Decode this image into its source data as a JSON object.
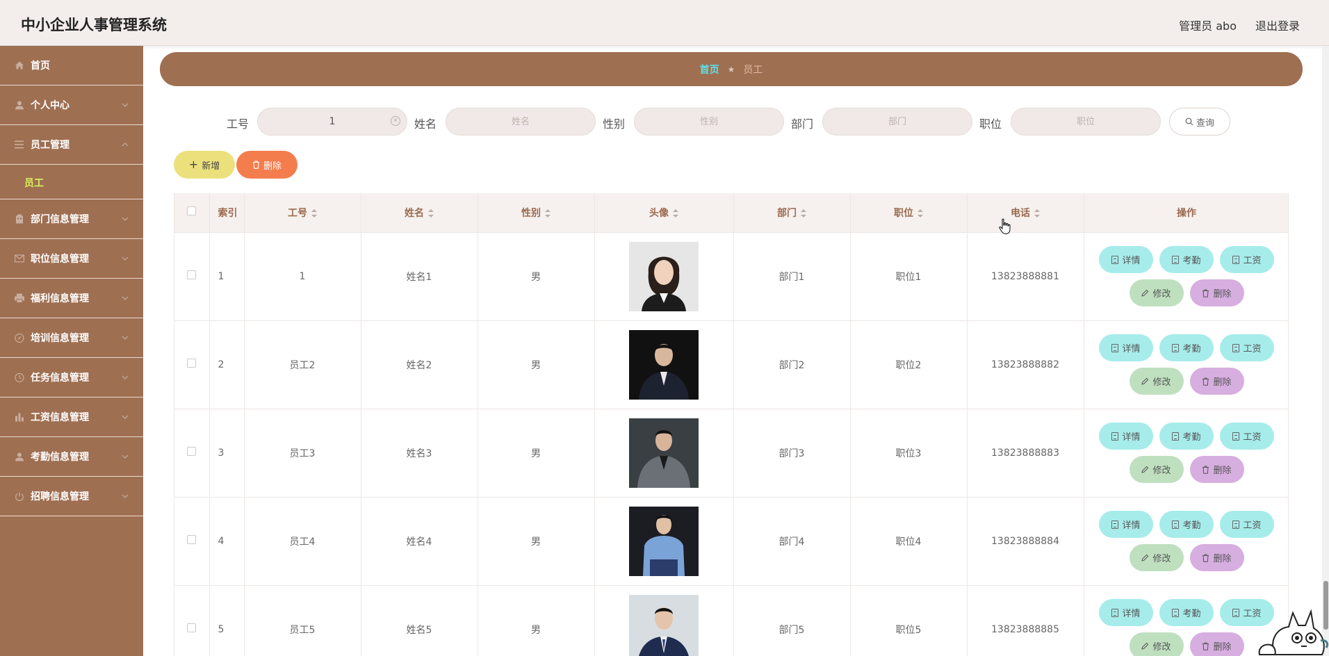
{
  "header": {
    "title": "中小企业人事管理系统",
    "admin": "管理员 abo",
    "logout": "退出登录"
  },
  "sidebar": {
    "items": [
      {
        "label": "首页",
        "icon": "home-icon"
      },
      {
        "label": "个人中心",
        "icon": "user-icon"
      },
      {
        "label": "员工管理",
        "icon": "menu-icon",
        "expanded": true
      },
      {
        "label": "部门信息管理",
        "icon": "building-icon"
      },
      {
        "label": "职位信息管理",
        "icon": "mail-icon"
      },
      {
        "label": "福利信息管理",
        "icon": "printer-icon"
      },
      {
        "label": "培训信息管理",
        "icon": "compass-icon"
      },
      {
        "label": "任务信息管理",
        "icon": "clock-icon"
      },
      {
        "label": "工资信息管理",
        "icon": "chart-icon"
      },
      {
        "label": "考勤信息管理",
        "icon": "user-icon"
      },
      {
        "label": "招聘信息管理",
        "icon": "power-icon"
      }
    ],
    "sub_item": "员工",
    "active_color": "#d9f05b"
  },
  "breadcrumb": {
    "home": "首页",
    "current": "员工"
  },
  "search": {
    "labels": {
      "id": "工号",
      "name": "姓名",
      "gender": "性别",
      "dept": "部门",
      "position": "职位"
    },
    "values": {
      "id": "1"
    },
    "placeholders": {
      "name": "姓名",
      "gender": "性别",
      "dept": "部门",
      "position": "职位"
    },
    "query": "查询"
  },
  "actions": {
    "add": "新增",
    "delete": "删除"
  },
  "table": {
    "headers": {
      "index": "索引",
      "id": "工号",
      "name": "姓名",
      "gender": "性别",
      "avatar": "头像",
      "dept": "部门",
      "position": "职位",
      "phone": "电话",
      "ops": "操作"
    },
    "rows": [
      {
        "index": "1",
        "id": "1",
        "name": "姓名1",
        "gender": "男",
        "dept": "部门1",
        "position": "职位1",
        "phone": "13823888881"
      },
      {
        "index": "2",
        "id": "员工2",
        "name": "姓名2",
        "gender": "男",
        "dept": "部门2",
        "position": "职位2",
        "phone": "13823888882"
      },
      {
        "index": "3",
        "id": "员工3",
        "name": "姓名3",
        "gender": "男",
        "dept": "部门3",
        "position": "职位3",
        "phone": "13823888883"
      },
      {
        "index": "4",
        "id": "员工4",
        "name": "姓名4",
        "gender": "男",
        "dept": "部门4",
        "position": "职位4",
        "phone": "13823888884"
      },
      {
        "index": "5",
        "id": "员工5",
        "name": "姓名5",
        "gender": "男",
        "dept": "部门5",
        "position": "职位5",
        "phone": "13823888885"
      }
    ],
    "op_labels": {
      "detail": "详情",
      "attend": "考勤",
      "salary": "工资",
      "edit": "修改",
      "delete": "删除"
    }
  },
  "colors": {
    "sidebar": "#9f6f52",
    "header_bg": "#f3eeec",
    "add_btn": "#ece07c",
    "delete_btn": "#f47d4e",
    "op_teal": "#a6eceb",
    "op_green": "#bfe0bf",
    "op_purple": "#d7aee0"
  }
}
